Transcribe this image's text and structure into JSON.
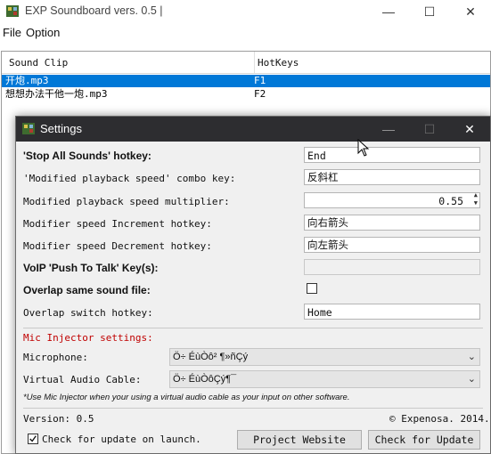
{
  "window": {
    "title": "EXP Soundboard vers. 0.5 |",
    "minimize": "—",
    "maximize": "☐",
    "close": "✕",
    "icon": "soundboard-app-icon"
  },
  "menu": {
    "file": "File",
    "option": "Option"
  },
  "table": {
    "headers": [
      "Sound Clip",
      "HotKeys"
    ],
    "rows": [
      {
        "clip": "开炮.mp3",
        "hotkey": "F1",
        "selected": true
      },
      {
        "clip": "想想办法干他一炮.mp3",
        "hotkey": "F2",
        "selected": false
      }
    ]
  },
  "settings": {
    "title": "Settings",
    "minimize": "—",
    "maximize": "☐",
    "close": "✕",
    "stop_all": {
      "label": "'Stop All Sounds' hotkey:",
      "value": "End"
    },
    "modified_combo": {
      "label": "'Modified playback speed' combo key:",
      "value": "反斜杠"
    },
    "multiplier": {
      "label": "Modified playback speed multiplier:",
      "value": "0.55"
    },
    "inc_hotkey": {
      "label": "Modifier speed Increment hotkey:",
      "value": "向右箭头"
    },
    "dec_hotkey": {
      "label": "Modifier speed Decrement hotkey:",
      "value": "向左箭头"
    },
    "voip": {
      "label": "VoIP 'Push To Talk' Key(s):",
      "value": ""
    },
    "overlap": {
      "label": "Overlap same sound file:",
      "checked": false
    },
    "overlap_switch": {
      "label": "Overlap switch hotkey:",
      "value": "Home"
    },
    "mic_injector_title": "Mic Injector settings:",
    "microphone": {
      "label": "Microphone:",
      "value": "Ö÷ ÉùÒô² ¶»ñÇý"
    },
    "virtual_cable": {
      "label": "Virtual Audio Cable:",
      "value": "Ö÷ ÉùÒôÇý¶¯"
    },
    "mic_note": "*Use Mic Injector when your using a virtual audio cable as your input on other software.",
    "version": "Version: 0.5",
    "copyright": "© Expenosa. 2014.",
    "check_update_launch": {
      "label": "Check for update on launch.",
      "checked": true
    },
    "project_website": "Project Website",
    "check_update": "Check for Update"
  },
  "colors": {
    "selection": "#0078d7",
    "dialog_titlebar": "#2d2d30",
    "mic_title": "#c00000"
  }
}
